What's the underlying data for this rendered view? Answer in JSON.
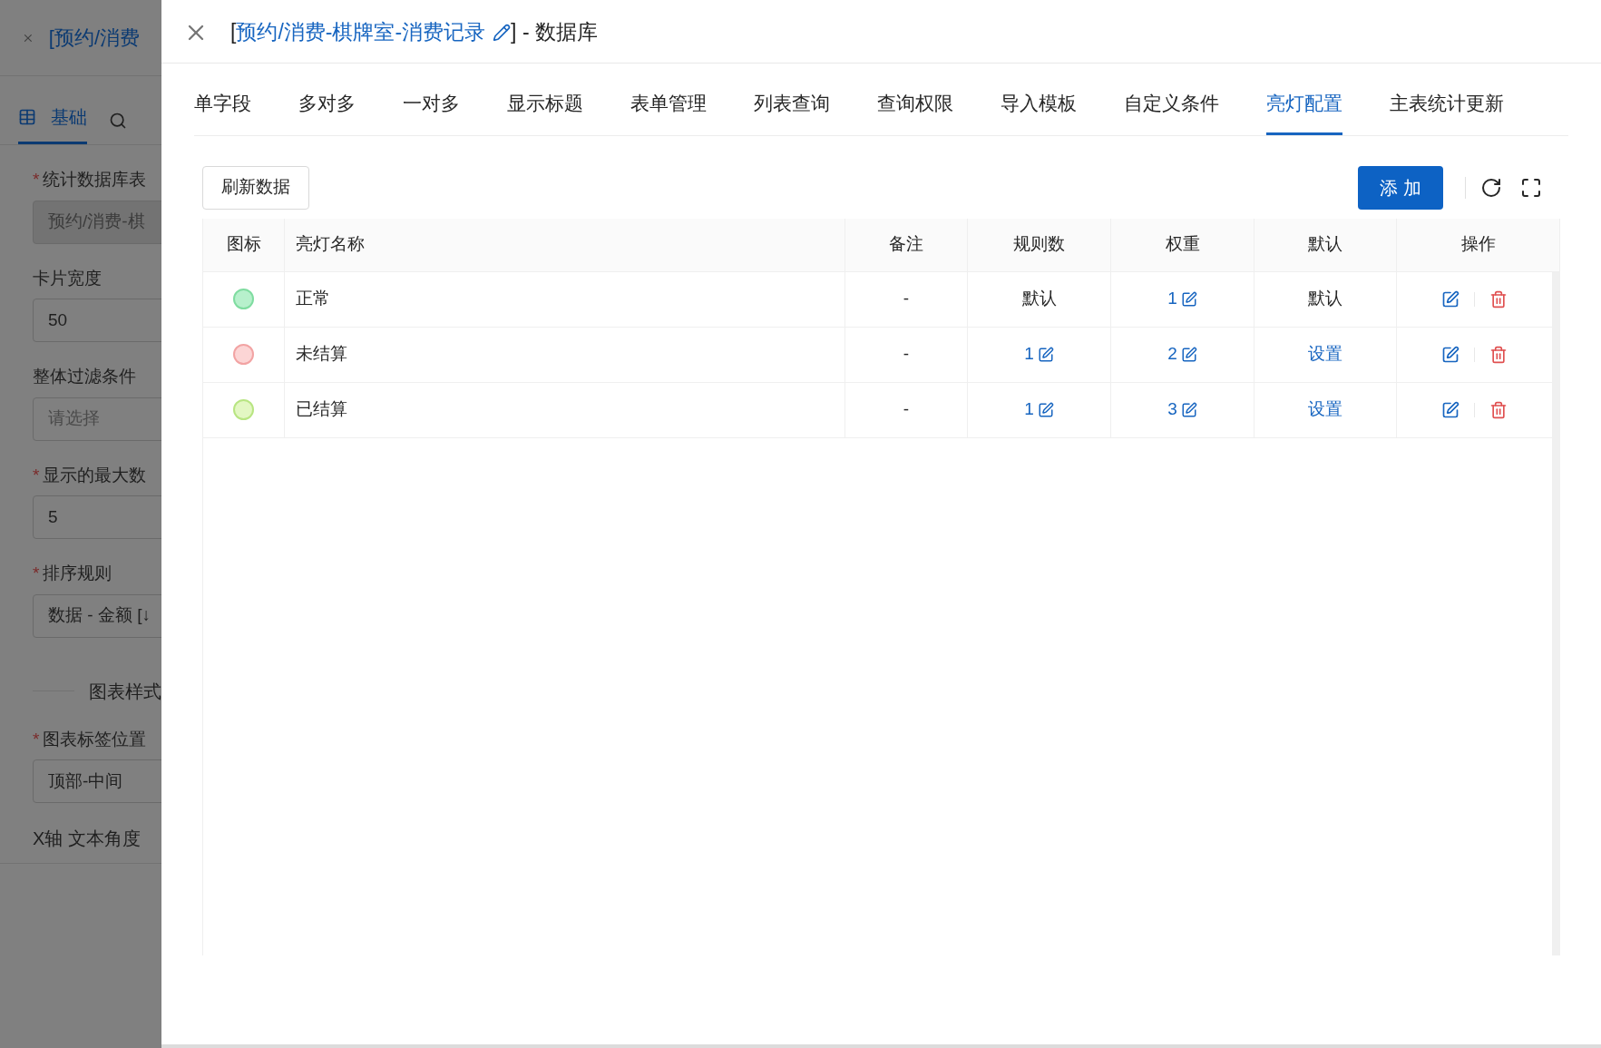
{
  "background_panel": {
    "title": "[预约/消费",
    "tabs": [
      {
        "label": "基础",
        "selected": true
      }
    ],
    "fields": [
      {
        "label": "统计数据库表",
        "required_mark": "*",
        "value": "预约/消费-棋",
        "disabled": true
      },
      {
        "label": "卡片宽度",
        "value": "50",
        "disabled": false
      },
      {
        "label": "整体过滤条件",
        "placeholder": "请选择",
        "disabled": false
      },
      {
        "label": "显示的最大数",
        "required_mark": "*",
        "value": "5",
        "disabled": false
      },
      {
        "label": "排序规则",
        "required_mark": "*",
        "value": "数据 - 金额 [↓",
        "disabled": false
      }
    ],
    "section": "图表样式",
    "fields_2": [
      {
        "label": "图表标签位置",
        "required_mark": "*",
        "value": "顶部-中间",
        "disabled": false
      }
    ],
    "last_label": "X轴 文本角度"
  },
  "drawer": {
    "title_prefix": "[",
    "title_link": "预约/消费-棋牌室-消费记录",
    "title_suffix": "] - 数据库",
    "tabs": [
      {
        "label": "单字段",
        "selected": false
      },
      {
        "label": "多对多",
        "selected": false
      },
      {
        "label": "一对多",
        "selected": false
      },
      {
        "label": "显示标题",
        "selected": false
      },
      {
        "label": "表单管理",
        "selected": false
      },
      {
        "label": "列表查询",
        "selected": false
      },
      {
        "label": "查询权限",
        "selected": false
      },
      {
        "label": "导入模板",
        "selected": false
      },
      {
        "label": "自定义条件",
        "selected": false
      },
      {
        "label": "亮灯配置",
        "selected": true
      },
      {
        "label": "主表统计更新",
        "selected": false
      }
    ],
    "refresh_button": "刷新数据",
    "add_button": "添 加",
    "table": {
      "columns": [
        "图标",
        "亮灯名称",
        "备注",
        "规则数",
        "权重",
        "默认",
        "操作"
      ],
      "rows": [
        {
          "color": "#b7f0cc",
          "name": "正常",
          "note": "-",
          "rules": {
            "text": "默认",
            "kind": "plain"
          },
          "weight": {
            "text": "1",
            "kind": "editable"
          },
          "default": {
            "text": "默认",
            "kind": "plain"
          }
        },
        {
          "color": "#fcd5d5",
          "name": "未结算",
          "note": "-",
          "rules": {
            "text": "1",
            "kind": "editable"
          },
          "weight": {
            "text": "2",
            "kind": "editable"
          },
          "default": {
            "text": "设置",
            "kind": "link"
          }
        },
        {
          "color": "#e3f7c3",
          "name": "已结算",
          "note": "-",
          "rules": {
            "text": "1",
            "kind": "editable"
          },
          "weight": {
            "text": "3",
            "kind": "editable"
          },
          "default": {
            "text": "设置",
            "kind": "link"
          }
        }
      ]
    }
  }
}
